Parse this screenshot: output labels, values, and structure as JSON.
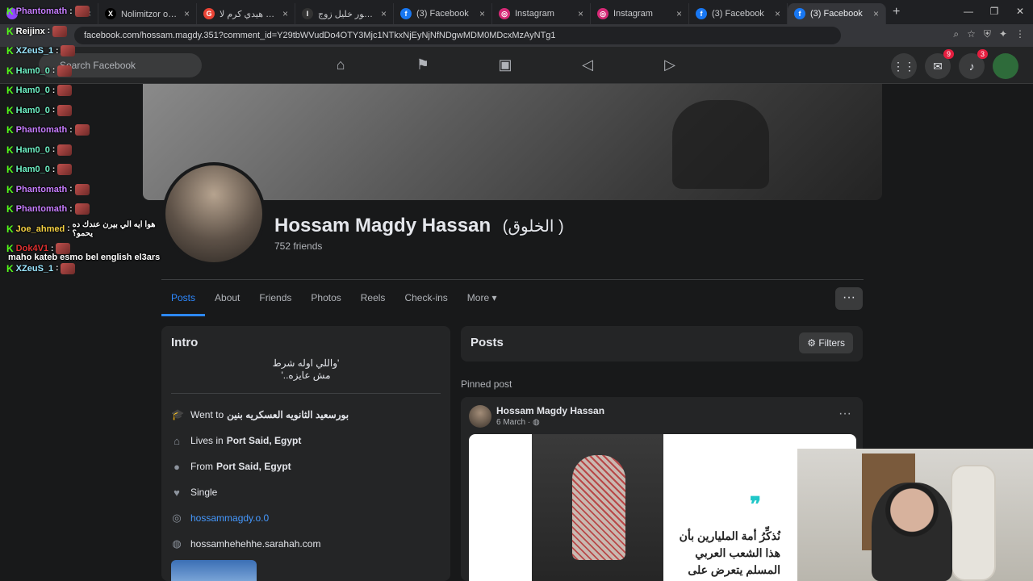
{
  "browser": {
    "tabs": [
      {
        "title": "",
        "color": "#9146ff",
        "glyph": "",
        "active": false
      },
      {
        "title": "Nolimitzor on X: \"🔥",
        "color": "#000000",
        "glyph": "X",
        "active": false
      },
      {
        "title": "كومنتات هيدي كرم لا...",
        "color": "#ea4335",
        "glyph": "G",
        "active": false
      },
      {
        "title": "أحمد تيمور خليل زوج...",
        "color": "#333333",
        "glyph": "I",
        "active": false
      },
      {
        "title": "(3) Facebook",
        "color": "#1877f2",
        "glyph": "f",
        "active": false
      },
      {
        "title": "Instagram",
        "color": "#d62976",
        "glyph": "◎",
        "active": false
      },
      {
        "title": "Instagram",
        "color": "#d62976",
        "glyph": "◎",
        "active": false
      },
      {
        "title": "(3) Facebook",
        "color": "#1877f2",
        "glyph": "f",
        "active": false
      },
      {
        "title": "(3) Facebook",
        "color": "#1877f2",
        "glyph": "f",
        "active": true
      }
    ],
    "url": "facebook.com/hossam.magdy.351?comment_id=Y29tbWVudDo4OTY3Mjc1NTkxNjEyNjNfNDgwMDM0MDcxMzAyNTg1",
    "window_controls": [
      "—",
      "❐",
      "✕"
    ]
  },
  "fb_header": {
    "search_placeholder": "Search Facebook",
    "messenger_badge": "9",
    "notifications_badge": "3"
  },
  "profile": {
    "name": "Hossam Magdy Hassan",
    "alt_name": "(الخلوق )",
    "friends": "752 friends",
    "tabs": [
      "Posts",
      "About",
      "Friends",
      "Photos",
      "Reels",
      "Check-ins"
    ],
    "more_label": "More"
  },
  "intro": {
    "title": "Intro",
    "bio_line1": "'واللي اوله شرط",
    "bio_line2": "مش عايزه..'",
    "rows": [
      {
        "prefix": "Went to ",
        "bold": "بورسعيد الثانويه العسكريه بنين",
        "icon": "graduation-cap"
      },
      {
        "prefix": "Lives in ",
        "bold": "Port Said, Egypt",
        "icon": "home"
      },
      {
        "prefix": "From ",
        "bold": "Port Said, Egypt",
        "icon": "location-pin"
      },
      {
        "prefix": "Single",
        "bold": "",
        "icon": "heart"
      }
    ],
    "instagram": "hossammagdy.o.0",
    "website": "hossamhehehhe.sarahah.com"
  },
  "posts": {
    "title": "Posts",
    "filters_label": "Filters",
    "pinned_label": "Pinned post",
    "post": {
      "author": "Hossam Magdy Hassan",
      "date": "6 March · ",
      "image_text": "نُذكِّرُ أمة المليارين بأن هذا الشعب العربي المسلم يتعرض على"
    }
  },
  "stream_chat": [
    {
      "name": "Phantomath",
      "color": "#c77dff",
      "msg": ""
    },
    {
      "name": "Reijinx",
      "color": "#ffffff",
      "msg": ""
    },
    {
      "name": "XZeuS_1",
      "color": "#9be7ff",
      "msg": ""
    },
    {
      "name": "Ham0_0",
      "color": "#6ef0c4",
      "msg": ""
    },
    {
      "name": "Ham0_0",
      "color": "#6ef0c4",
      "msg": ""
    },
    {
      "name": "Ham0_0",
      "color": "#6ef0c4",
      "msg": ""
    },
    {
      "name": "Phantomath",
      "color": "#c77dff",
      "msg": ""
    },
    {
      "name": "Ham0_0",
      "color": "#6ef0c4",
      "msg": ""
    },
    {
      "name": "Ham0_0",
      "color": "#6ef0c4",
      "msg": ""
    },
    {
      "name": "Phantomath",
      "color": "#c77dff",
      "msg": ""
    },
    {
      "name": "Phantomath",
      "color": "#c77dff",
      "msg": ""
    },
    {
      "name": "Joe_ahmed",
      "color": "#f5d142",
      "msg": "هوا ايه الي بيرن عندك ده يحمو؟"
    },
    {
      "name": "Dok4V1",
      "color": "#e03030",
      "msg": ""
    },
    {
      "name": "XZeuS_1",
      "color": "#9be7ff",
      "msg": ""
    }
  ],
  "stream_msg": "maho kateb esmo bel english el3ars"
}
